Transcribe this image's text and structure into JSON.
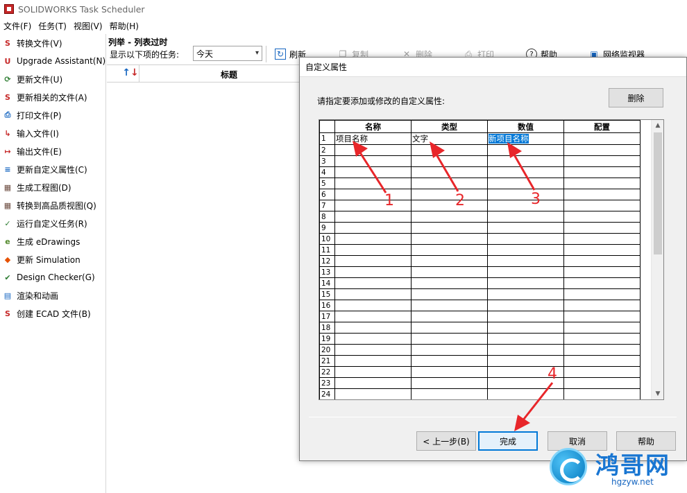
{
  "window": {
    "title": "SOLIDWORKS Task Scheduler"
  },
  "menubar": [
    "文件(F)",
    "任务(T)",
    "视图(V)",
    "帮助(H)"
  ],
  "sidebar": {
    "items": [
      {
        "label": "转换文件(V)",
        "icon": "convert-files-icon",
        "color": "#c62828"
      },
      {
        "label": "Upgrade Assistant(N)",
        "icon": "upgrade-assistant-icon",
        "color": "#c62828"
      },
      {
        "label": "更新文件(U)",
        "icon": "update-files-icon",
        "color": "#2e7d32"
      },
      {
        "label": "更新相关的文件(A)",
        "icon": "update-related-files-icon",
        "color": "#c62828"
      },
      {
        "label": "打印文件(P)",
        "icon": "printer-icon",
        "color": "#1565c0"
      },
      {
        "label": "输入文件(I)",
        "icon": "import-files-icon",
        "color": "#c62828"
      },
      {
        "label": "输出文件(E)",
        "icon": "export-files-icon",
        "color": "#c62828"
      },
      {
        "label": "更新自定义属性(C)",
        "icon": "custom-properties-icon",
        "color": "#1565c0"
      },
      {
        "label": "生成工程图(D)",
        "icon": "drawing-icon",
        "color": "#6d4c41"
      },
      {
        "label": "转换到高品质视图(Q)",
        "icon": "hq-view-icon",
        "color": "#6d4c41"
      },
      {
        "label": "运行自定义任务(R)",
        "icon": "custom-task-icon",
        "color": "#2e7d32"
      },
      {
        "label": "生成 eDrawings",
        "icon": "edrawings-icon",
        "color": "#558b2f"
      },
      {
        "label": "更新 Simulation",
        "icon": "simulation-icon",
        "color": "#e65100"
      },
      {
        "label": "Design Checker(G)",
        "icon": "design-checker-icon",
        "color": "#2e7d32"
      },
      {
        "label": "渲染和动画",
        "icon": "render-animation-icon",
        "color": "#1565c0"
      },
      {
        "label": "创建 ECAD 文件(B)",
        "icon": "ecad-icon",
        "color": "#c62828"
      }
    ]
  },
  "main": {
    "list_title": "列举 - 列表过时",
    "filter_label": "显示以下项的任务:",
    "filter_value": "今天",
    "toolbar": {
      "refresh": "刷新",
      "copy": "复制",
      "delete": "删除",
      "print": "打印",
      "help": "帮助",
      "network_monitor": "网络监视器"
    },
    "header_title": "标题"
  },
  "dialog": {
    "title": "自定义属性",
    "prompt": "请指定要添加或修改的自定义属性:",
    "delete_button": "删除",
    "columns": [
      "名称",
      "类型",
      "数值",
      "配置"
    ],
    "rows": [
      {
        "num": "1",
        "name": "项目名称",
        "type": "文字",
        "value": "新项目名称",
        "config": ""
      },
      {
        "num": "2"
      },
      {
        "num": "3"
      },
      {
        "num": "4"
      },
      {
        "num": "5"
      },
      {
        "num": "6"
      },
      {
        "num": "7"
      },
      {
        "num": "8"
      },
      {
        "num": "9"
      },
      {
        "num": "10"
      },
      {
        "num": "11"
      },
      {
        "num": "12"
      },
      {
        "num": "13"
      },
      {
        "num": "14"
      },
      {
        "num": "15"
      },
      {
        "num": "16"
      },
      {
        "num": "17"
      },
      {
        "num": "18"
      },
      {
        "num": "19"
      },
      {
        "num": "20"
      },
      {
        "num": "21"
      },
      {
        "num": "22"
      },
      {
        "num": "23"
      },
      {
        "num": "24"
      }
    ],
    "buttons": {
      "back": "< 上一步(B)",
      "finish": "完成",
      "cancel": "取消",
      "help": "帮助"
    }
  },
  "annotations": [
    "1",
    "2",
    "3",
    "4"
  ],
  "annotation_color": "#e8262a",
  "selection_color": "#0078d7",
  "watermark": {
    "title": "鸿哥网",
    "url": "hgzyw.net"
  }
}
